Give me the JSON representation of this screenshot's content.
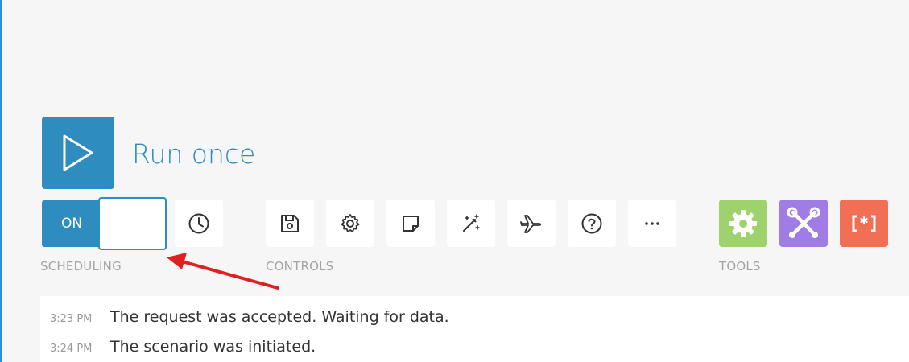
{
  "run": {
    "label": "Run once",
    "icon": "play-icon"
  },
  "scheduling": {
    "toggle_label": "ON",
    "group_label": "SCHEDULING",
    "clock_icon": "clock-icon"
  },
  "controls": {
    "group_label": "CONTROLS",
    "buttons": [
      {
        "name": "save",
        "icon": "save-icon"
      },
      {
        "name": "settings",
        "icon": "gear-icon"
      },
      {
        "name": "notes",
        "icon": "note-icon"
      },
      {
        "name": "auto-align",
        "icon": "magic-wand-icon"
      },
      {
        "name": "explain-flow",
        "icon": "airplane-icon"
      },
      {
        "name": "help",
        "icon": "question-icon"
      },
      {
        "name": "more",
        "icon": "more-icon"
      }
    ]
  },
  "tools": {
    "group_label": "TOOLS",
    "buttons": [
      {
        "name": "tools",
        "icon": "gear-icon",
        "color": "#9dd26d"
      },
      {
        "name": "flow-control",
        "icon": "wrench-cross-icon",
        "color": "#a07ce6"
      },
      {
        "name": "text-parser",
        "icon": "bracket-asterisk-icon",
        "color": "#f26f55"
      }
    ]
  },
  "log": {
    "entries": [
      {
        "time": "3:23 PM",
        "text": "The request was accepted. Waiting for data."
      },
      {
        "time": "3:24 PM",
        "text": "The scenario was initiated."
      }
    ]
  },
  "colors": {
    "accent": "#2f8cbf",
    "arrow": "#e02020",
    "background": "#f6f6f6"
  }
}
